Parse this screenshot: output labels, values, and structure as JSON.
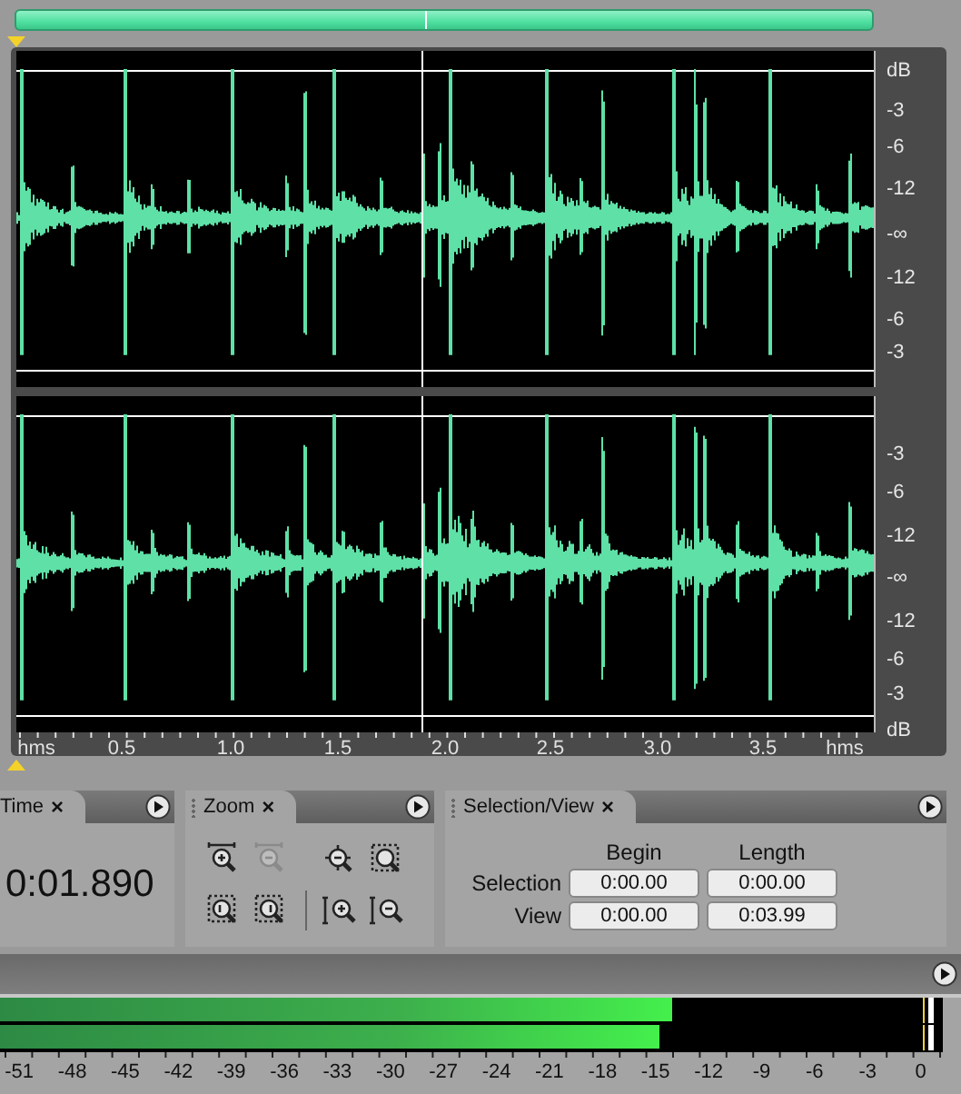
{
  "waveform": {
    "channels": [
      {
        "db_labels": [
          "dB",
          "-3",
          "-6",
          "-12",
          "-∞",
          "-12",
          "-6",
          "-3"
        ]
      },
      {
        "db_labels": [
          "-3",
          "-6",
          "-12",
          "-∞",
          "-12",
          "-6",
          "-3",
          "dB"
        ]
      }
    ],
    "time_ruler": [
      "hms",
      "0.5",
      "1.0",
      "1.5",
      "2.0",
      "2.5",
      "3.0",
      "3.5",
      "hms"
    ]
  },
  "panels": [
    {
      "kind": "time",
      "tab": "Time",
      "close": "×",
      "value": "0:01.890"
    },
    {
      "kind": "zoom",
      "tab": "Zoom",
      "close": "×",
      "buttons": [
        {
          "kind": "in_h",
          "disabled": false
        },
        {
          "kind": "out_h",
          "disabled": true
        },
        {
          "kind": "out_full",
          "disabled": false
        },
        {
          "kind": "selection",
          "disabled": false
        },
        {
          "kind": "in_left",
          "disabled": false
        },
        {
          "kind": "in_right",
          "disabled": false
        },
        {
          "kind": "in_v",
          "disabled": false
        },
        {
          "kind": "out_v",
          "disabled": false
        }
      ]
    },
    {
      "kind": "selection",
      "tab": "Selection/View",
      "close": "×",
      "columns": [
        "Begin",
        "Length"
      ],
      "rows": [
        {
          "label": "Selection",
          "begin": "0:00.00",
          "length": "0:00.00"
        },
        {
          "label": "View",
          "begin": "0:00.00",
          "length": "0:03.99"
        }
      ]
    }
  ],
  "meter": {
    "channels": [
      {
        "level": 0.73
      },
      {
        "level": 0.715
      }
    ],
    "scale": [
      "-51",
      "-48",
      "-45",
      "-42",
      "-39",
      "-36",
      "-33",
      "-30",
      "-27",
      "-24",
      "-21",
      "-18",
      "-15",
      "-12",
      "-9",
      "-6",
      "-3",
      "0"
    ]
  }
}
